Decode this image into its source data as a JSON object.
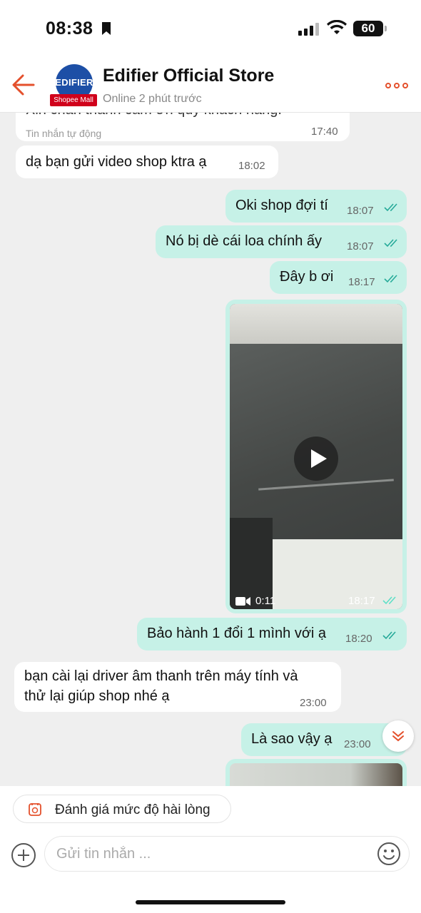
{
  "status_bar": {
    "time": "08:38",
    "battery": "60"
  },
  "header": {
    "avatar_brand": "EDIFIER",
    "avatar_mall_label": "Shopee Mall",
    "store_name": "Edifier Official Store",
    "online_status": "Online 2 phút trước"
  },
  "messages": [
    {
      "side": "in",
      "text": "Xin chân thành cảm ơn quý khách hàng!",
      "sub": "Tin nhắn tự động",
      "time": "17:40"
    },
    {
      "side": "in",
      "text": "dạ bạn gửi video shop  ktra ạ",
      "time": "18:02"
    },
    {
      "side": "out",
      "text": "Oki shop đợi tí",
      "time": "18:07"
    },
    {
      "side": "out",
      "text": "Nó bị dè cái loa chính ấy",
      "time": "18:07"
    },
    {
      "side": "out",
      "text": "Đây b ơi",
      "time": "18:17"
    },
    {
      "side": "out",
      "type": "video",
      "duration": "0:11",
      "time": "18:17"
    },
    {
      "side": "out",
      "text": "Bảo hành 1 đổi 1 mình với ạ",
      "time": "18:20"
    },
    {
      "side": "in",
      "text_line1": "bạn cài lại driver âm thanh trên máy tính và",
      "text_line2": "thử lại giúp shop nhé ạ",
      "time": "23:00"
    },
    {
      "side": "out",
      "text": "Là sao vậy ạ",
      "time": "23:00"
    }
  ],
  "bottom": {
    "rating_label": "Đánh giá mức độ hài lòng",
    "input_placeholder": "Gửi tin nhắn ..."
  },
  "colors": {
    "accent": "#ee4d2d",
    "out_bubble": "#c6f1e7",
    "in_bubble": "#ffffff",
    "tick": "#26aa99"
  }
}
